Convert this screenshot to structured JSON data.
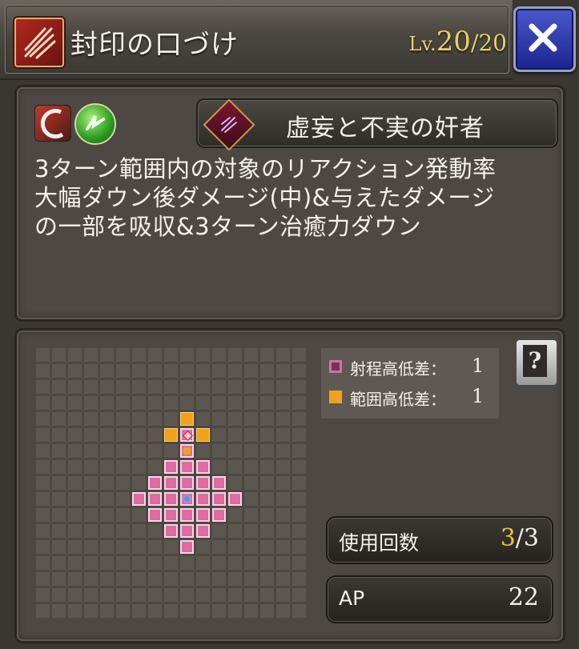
{
  "header": {
    "title": "封印の口づけ",
    "level_label": "Lv.",
    "level_current": "20",
    "level_max": "/20"
  },
  "skill": {
    "attribute_icons": [
      "slash-icon",
      "wind-element-icon"
    ],
    "counter_name": "虚妄と不実の奸者",
    "description_lines": [
      "3ターン範囲内の対象のリアクション発動率",
      "大幅ダウン後ダメージ(中)&与えたダメージ",
      "の一部を吸収&3ターン治癒力ダウン"
    ]
  },
  "range_map": {
    "columns": 17,
    "rows": 17,
    "cells": [
      ".................",
      ".................",
      ".................",
      ".................",
      ".........O.......",
      "........OTO......",
      ".........Q.......",
      "........PPP......",
      ".......PPPPP.....",
      "......PPPCPPP....",
      ".......PPPPP.....",
      "........PPP......",
      ".........P.......",
      ".................",
      ".................",
      ".................",
      "................."
    ],
    "legend": [
      {
        "label": "射程高低差：",
        "value": "1",
        "color": "#e06aa2"
      },
      {
        "label": "範囲高低差：",
        "value": "1",
        "color": "#f0a31a"
      }
    ]
  },
  "stats": {
    "uses_label": "使用回数",
    "uses_current": "3",
    "uses_max": "/3",
    "ap_label": "AP",
    "ap_value": "22"
  },
  "help_label": "?",
  "colors": {
    "accent_gold": "#e8cf6b",
    "range_pink": "#e06aa2",
    "area_orange": "#f0a31a",
    "close_blue": "#2a36b0"
  }
}
